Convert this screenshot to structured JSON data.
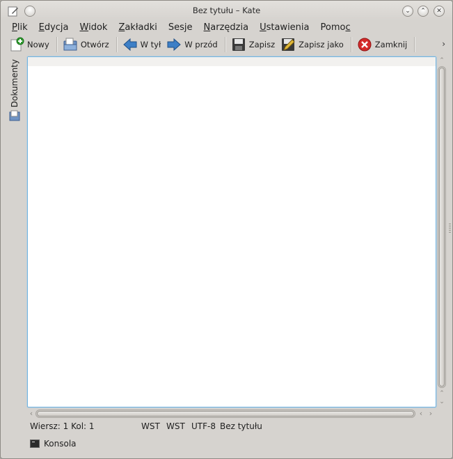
{
  "window": {
    "title": "Bez tytułu – Kate"
  },
  "menubar": {
    "items": [
      {
        "label": "Plik",
        "mnemonic": "P",
        "rest": "lik"
      },
      {
        "label": "Edycja",
        "mnemonic": "E",
        "rest": "dycja"
      },
      {
        "label": "Widok",
        "mnemonic": "W",
        "rest": "idok"
      },
      {
        "label": "Zakładki",
        "mnemonic": "Z",
        "rest": "akładki"
      },
      {
        "label": "Sesje",
        "mnemonic": "",
        "rest": "Sesje"
      },
      {
        "label": "Narzędzia",
        "mnemonic": "N",
        "rest": "arzędzia"
      },
      {
        "label": "Ustawienia",
        "mnemonic": "U",
        "rest": "stawienia"
      },
      {
        "label": "Pomoc",
        "pre": "Pomo",
        "mnemonic": "c"
      }
    ]
  },
  "toolbar": {
    "new_label": "Nowy",
    "open_label": "Otwórz",
    "back_label": "W tył",
    "forward_label": "W przód",
    "save_label": "Zapisz",
    "save_as_label": "Zapisz jako",
    "close_label": "Zamknij",
    "more_label": "›"
  },
  "sidebar": {
    "documents_label": "Dokumenty"
  },
  "editor": {
    "content": ""
  },
  "statusbar": {
    "position": "Wiersz: 1 Kol: 1",
    "mode1": "WST",
    "mode2": "WST",
    "encoding": "UTF-8",
    "filename": "Bez tytułu"
  },
  "bottom_dock": {
    "console_label": "Konsola"
  },
  "colors": {
    "window_bg": "#d6d3cf",
    "editor_bg": "#ffffff",
    "focus_border": "#6fb2e0",
    "close_icon_red": "#d42a2a",
    "arrow_blue": "#3d7fc6"
  }
}
